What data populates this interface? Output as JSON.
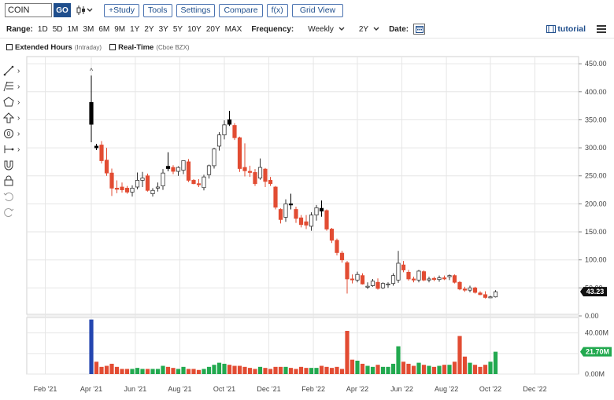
{
  "toolbar": {
    "symbol": "COIN",
    "go_label": "GO",
    "study_label": "+Study",
    "tools_label": "Tools",
    "settings_label": "Settings",
    "compare_label": "Compare",
    "fx_label": "f(x)",
    "gridview_label": "Grid View"
  },
  "range_bar": {
    "range_label": "Range:",
    "ranges": [
      "1D",
      "5D",
      "1M",
      "3M",
      "6M",
      "9M",
      "1Y",
      "2Y",
      "3Y",
      "5Y",
      "10Y",
      "20Y",
      "MAX"
    ],
    "frequency_label": "Frequency:",
    "frequency_value": "Weekly",
    "period_value": "2Y",
    "date_label": "Date:",
    "tutorial_label": "tutorial"
  },
  "options": {
    "extended_label": "Extended Hours",
    "extended_sub": "(Intraday)",
    "realtime_label": "Real-Time",
    "realtime_sub": "(Cboe BZX)"
  },
  "colors": {
    "up": "#ffffff",
    "up_border": "#333333",
    "down": "#e24c33",
    "volume_up": "#22a94f",
    "volume_down": "#e24c33",
    "volume_first": "#2446b0",
    "grid": "#e6e6e6"
  },
  "chart_data": {
    "type": "candlestick",
    "price_axis": {
      "ticks": [
        "450.00",
        "400.00",
        "350.00",
        "300.00",
        "250.00",
        "200.00",
        "150.00",
        "100.00",
        "50.00",
        "0.00"
      ],
      "ylim": [
        0,
        460
      ],
      "last_price": "43.23"
    },
    "volume_axis": {
      "ticks": [
        "40.00M",
        "20.00M",
        "0.00M"
      ],
      "ylim": [
        0,
        55
      ],
      "last_volume": "21.70M"
    },
    "x_ticks": [
      "Feb '21",
      "Apr '21",
      "Jun '21",
      "Aug '21",
      "Oct '21",
      "Dec '21",
      "Feb '22",
      "Apr '22",
      "Jun '22",
      "Aug '22",
      "Oct '22",
      "Dec '22"
    ],
    "x_tick_weeks": [
      -9,
      0,
      8.6,
      17.3,
      26,
      34.7,
      43.4,
      52,
      60.7,
      69.4,
      78,
      86.7
    ],
    "first_candle_label": "^",
    "candles": [
      {
        "o": 381,
        "h": 429,
        "l": 310,
        "c": 342,
        "v": 53,
        "filled": true
      },
      {
        "o": 303,
        "h": 307,
        "l": 296,
        "c": 300,
        "v": 12,
        "filled": true
      },
      {
        "o": 305,
        "h": 312,
        "l": 272,
        "c": 277,
        "v": 7
      },
      {
        "o": 278,
        "h": 300,
        "l": 250,
        "c": 255,
        "v": 8
      },
      {
        "o": 255,
        "h": 263,
        "l": 214,
        "c": 228,
        "v": 10
      },
      {
        "o": 228,
        "h": 242,
        "l": 219,
        "c": 226,
        "v": 7
      },
      {
        "o": 230,
        "h": 238,
        "l": 220,
        "c": 225,
        "v": 5
      },
      {
        "o": 228,
        "h": 232,
        "l": 218,
        "c": 221,
        "v": 5
      },
      {
        "o": 221,
        "h": 233,
        "l": 213,
        "c": 228,
        "v": 5
      },
      {
        "o": 230,
        "h": 256,
        "l": 226,
        "c": 242,
        "v": 6,
        "up": true
      },
      {
        "o": 242,
        "h": 257,
        "l": 230,
        "c": 246,
        "v": 5,
        "up": true
      },
      {
        "o": 250,
        "h": 254,
        "l": 222,
        "c": 224,
        "v": 5
      },
      {
        "o": 224,
        "h": 228,
        "l": 213,
        "c": 218,
        "v": 5,
        "up": true
      },
      {
        "o": 228,
        "h": 238,
        "l": 222,
        "c": 230,
        "v": 5
      },
      {
        "o": 232,
        "h": 262,
        "l": 225,
        "c": 255,
        "v": 8,
        "up": true
      },
      {
        "o": 267,
        "h": 292,
        "l": 258,
        "c": 263,
        "v": 7,
        "filled": true
      },
      {
        "o": 265,
        "h": 269,
        "l": 253,
        "c": 258,
        "v": 6
      },
      {
        "o": 258,
        "h": 267,
        "l": 250,
        "c": 265,
        "v": 5,
        "up": true
      },
      {
        "o": 260,
        "h": 276,
        "l": 253,
        "c": 277,
        "v": 7,
        "up": true
      },
      {
        "o": 275,
        "h": 280,
        "l": 239,
        "c": 242,
        "v": 5
      },
      {
        "o": 242,
        "h": 244,
        "l": 235,
        "c": 236,
        "v": 5
      },
      {
        "o": 236,
        "h": 244,
        "l": 230,
        "c": 234,
        "v": 4
      },
      {
        "o": 229,
        "h": 252,
        "l": 224,
        "c": 248,
        "v": 5,
        "up": true
      },
      {
        "o": 252,
        "h": 270,
        "l": 245,
        "c": 268,
        "v": 7,
        "up": true
      },
      {
        "o": 268,
        "h": 300,
        "l": 263,
        "c": 298,
        "v": 9,
        "up": true
      },
      {
        "o": 303,
        "h": 328,
        "l": 295,
        "c": 323,
        "v": 11,
        "up": true
      },
      {
        "o": 323,
        "h": 349,
        "l": 315,
        "c": 341,
        "v": 10,
        "up": true
      },
      {
        "o": 350,
        "h": 366,
        "l": 339,
        "c": 342,
        "v": 9,
        "filled": true
      },
      {
        "o": 340,
        "h": 344,
        "l": 314,
        "c": 318,
        "v": 8
      },
      {
        "o": 318,
        "h": 320,
        "l": 257,
        "c": 263,
        "v": 8
      },
      {
        "o": 265,
        "h": 308,
        "l": 249,
        "c": 259,
        "v": 7
      },
      {
        "o": 258,
        "h": 268,
        "l": 248,
        "c": 256,
        "v": 6
      },
      {
        "o": 256,
        "h": 262,
        "l": 232,
        "c": 236,
        "v": 5
      },
      {
        "o": 246,
        "h": 281,
        "l": 243,
        "c": 265,
        "v": 7
      },
      {
        "o": 262,
        "h": 264,
        "l": 230,
        "c": 240,
        "v": 6
      },
      {
        "o": 242,
        "h": 248,
        "l": 232,
        "c": 236,
        "v": 5
      },
      {
        "o": 230,
        "h": 232,
        "l": 190,
        "c": 194,
        "v": 7
      },
      {
        "o": 190,
        "h": 192,
        "l": 165,
        "c": 172,
        "v": 7
      },
      {
        "o": 176,
        "h": 208,
        "l": 168,
        "c": 200,
        "v": 7,
        "up": true
      },
      {
        "o": 200,
        "h": 218,
        "l": 190,
        "c": 198,
        "v": 6,
        "filled": true
      },
      {
        "o": 190,
        "h": 195,
        "l": 166,
        "c": 174,
        "v": 5
      },
      {
        "o": 175,
        "h": 180,
        "l": 158,
        "c": 163,
        "v": 7
      },
      {
        "o": 168,
        "h": 180,
        "l": 155,
        "c": 162,
        "v": 6
      },
      {
        "o": 160,
        "h": 185,
        "l": 152,
        "c": 180,
        "v": 6,
        "up": true
      },
      {
        "o": 180,
        "h": 198,
        "l": 170,
        "c": 193,
        "v": 6,
        "up": true
      },
      {
        "o": 192,
        "h": 206,
        "l": 177,
        "c": 187,
        "v": 8,
        "filled": true
      },
      {
        "o": 188,
        "h": 190,
        "l": 152,
        "c": 155,
        "v": 7
      },
      {
        "o": 155,
        "h": 157,
        "l": 130,
        "c": 135,
        "v": 6
      },
      {
        "o": 135,
        "h": 138,
        "l": 108,
        "c": 113,
        "v": 7
      },
      {
        "o": 112,
        "h": 116,
        "l": 95,
        "c": 100,
        "v": 5
      },
      {
        "o": 95,
        "h": 98,
        "l": 40,
        "c": 66,
        "v": 42
      },
      {
        "o": 66,
        "h": 74,
        "l": 58,
        "c": 66,
        "v": 14
      },
      {
        "o": 64,
        "h": 79,
        "l": 60,
        "c": 74,
        "v": 13,
        "up": true
      },
      {
        "o": 72,
        "h": 76,
        "l": 56,
        "c": 57,
        "v": 10
      },
      {
        "o": 53,
        "h": 60,
        "l": 48,
        "c": 52,
        "v": 8,
        "up": true
      },
      {
        "o": 54,
        "h": 66,
        "l": 52,
        "c": 62,
        "v": 7,
        "up": true
      },
      {
        "o": 60,
        "h": 67,
        "l": 47,
        "c": 49,
        "v": 9
      },
      {
        "o": 50,
        "h": 60,
        "l": 48,
        "c": 58,
        "v": 7,
        "up": true
      },
      {
        "o": 56,
        "h": 60,
        "l": 50,
        "c": 57,
        "v": 7
      },
      {
        "o": 58,
        "h": 76,
        "l": 54,
        "c": 72,
        "v": 10,
        "up": true
      },
      {
        "o": 64,
        "h": 116,
        "l": 59,
        "c": 94,
        "v": 27,
        "up": true
      },
      {
        "o": 91,
        "h": 98,
        "l": 78,
        "c": 82,
        "v": 12
      },
      {
        "o": 78,
        "h": 82,
        "l": 63,
        "c": 66,
        "v": 10
      },
      {
        "o": 66,
        "h": 70,
        "l": 60,
        "c": 64,
        "v": 8
      },
      {
        "o": 64,
        "h": 82,
        "l": 60,
        "c": 80,
        "v": 11,
        "up": true
      },
      {
        "o": 79,
        "h": 81,
        "l": 62,
        "c": 64,
        "v": 9
      },
      {
        "o": 64,
        "h": 70,
        "l": 60,
        "c": 66,
        "v": 8,
        "up": true
      },
      {
        "o": 67,
        "h": 70,
        "l": 62,
        "c": 65,
        "v": 7
      },
      {
        "o": 65,
        "h": 72,
        "l": 61,
        "c": 68,
        "v": 8,
        "up": true
      },
      {
        "o": 68,
        "h": 72,
        "l": 64,
        "c": 66,
        "v": 9
      },
      {
        "o": 70,
        "h": 74,
        "l": 64,
        "c": 72,
        "v": 9,
        "up": true
      },
      {
        "o": 72,
        "h": 74,
        "l": 58,
        "c": 60,
        "v": 12
      },
      {
        "o": 60,
        "h": 62,
        "l": 46,
        "c": 48,
        "v": 37
      },
      {
        "o": 48,
        "h": 52,
        "l": 43,
        "c": 46,
        "v": 17
      },
      {
        "o": 46,
        "h": 54,
        "l": 42,
        "c": 50,
        "v": 11,
        "up": true
      },
      {
        "o": 50,
        "h": 52,
        "l": 40,
        "c": 42,
        "v": 9
      },
      {
        "o": 41,
        "h": 44,
        "l": 37,
        "c": 38,
        "v": 7
      },
      {
        "o": 38,
        "h": 44,
        "l": 31,
        "c": 33,
        "v": 9
      },
      {
        "o": 33,
        "h": 36,
        "l": 32,
        "c": 34,
        "v": 12
      },
      {
        "o": 34,
        "h": 46,
        "l": 33,
        "c": 43,
        "v": 21.7,
        "up": true
      }
    ]
  }
}
